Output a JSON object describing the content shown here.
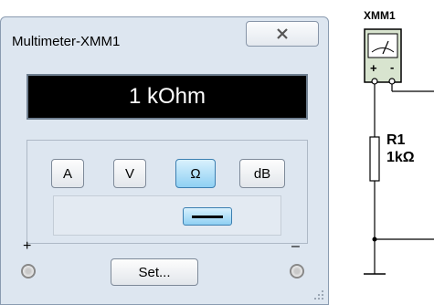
{
  "window": {
    "title": "Multimeter-XMM1",
    "display_value": "1 kOhm",
    "modes": [
      "A",
      "V",
      "Ω",
      "dB"
    ],
    "active_mode": "Ω",
    "signal_mode": "DC",
    "set_label": "Set...",
    "plus_label": "+",
    "minus_label": "–"
  },
  "schematic": {
    "instrument_label": "XMM1",
    "meter_plus": "+",
    "meter_minus": "-",
    "resistor_name": "R1",
    "resistor_value": "1kΩ"
  },
  "colors": {
    "window_bg": "#dde6f0",
    "display_bg": "#000000",
    "active_button": "#8fd0f3",
    "instrument_fill": "#d8e4cf"
  }
}
